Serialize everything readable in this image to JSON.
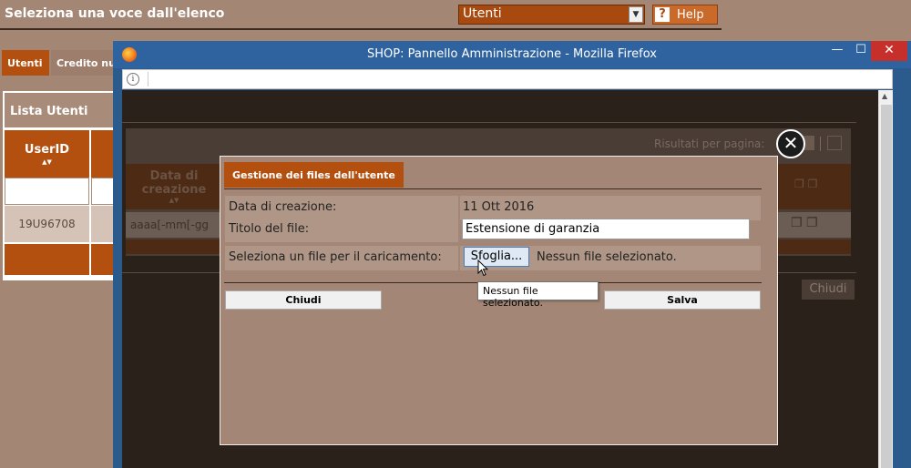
{
  "app": {
    "title": "Seleziona una voce dall'elenco",
    "entity_select": "Utenti",
    "help_label": "Help",
    "help_glyph": "?"
  },
  "tabs": [
    {
      "label": "Utenti",
      "active": true
    },
    {
      "label": "Credito nu",
      "active": false
    }
  ],
  "users_list": {
    "title": "Lista Utenti",
    "column_userid": "UserID",
    "sort_glyph": "▲▼",
    "rows": [
      {
        "userid": "19U96708"
      }
    ]
  },
  "browser": {
    "window_title": "SHOP: Pannello Amministrazione - Mozilla Firefox",
    "minimize_glyph": "—",
    "maximize_glyph": "☐",
    "close_glyph": "✕",
    "info_glyph": "i"
  },
  "files_page": {
    "results_per_page_label": "Risultati per pagina:",
    "column_date": "Data di creazione",
    "date_filter_placeholder": "aaaa[-mm[-gg",
    "close_label": "Chiudi"
  },
  "modal": {
    "heading": "Gestione dei files dell'utente",
    "creation_date_label": "Data di creazione:",
    "creation_date_value": "11 Ott 2016",
    "file_title_label": "Titolo del file:",
    "file_title_value": "Estensione di garanzia",
    "upload_label": "Seleziona un file per il caricamento:",
    "browse_label": "Sfoglia...",
    "no_file_text": "Nessun file selezionato.",
    "tooltip_text": "Nessun file selezionato.",
    "close_button": "Chiudi",
    "save_button": "Salva",
    "close_glyph": "✕"
  },
  "colors": {
    "brand_orange": "#b3500f",
    "background_tan": "#a48675",
    "firefox_chrome": "#2e63a0",
    "window_close_red": "#c7302a"
  }
}
